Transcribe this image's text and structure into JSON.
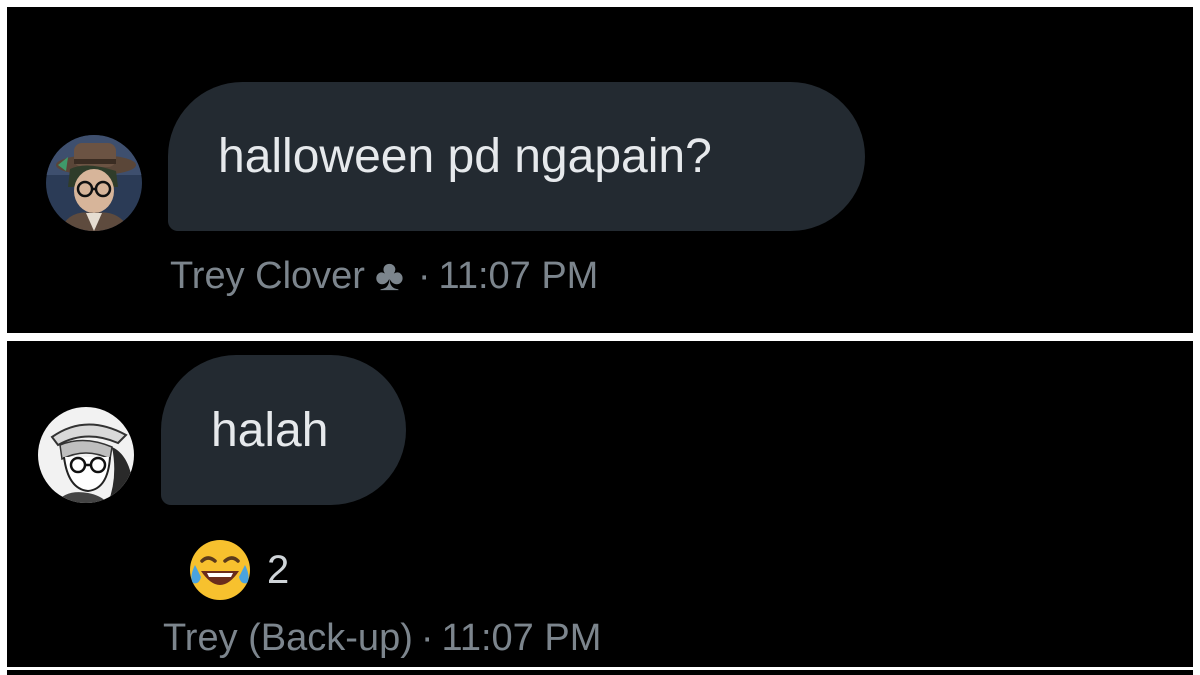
{
  "messages": [
    {
      "text": "halloween pd ngapain?",
      "sender": "Trey Clover",
      "sender_symbol": "♣",
      "separator": "·",
      "time": "11:07 PM",
      "avatar_icon": "hatted-glasses-avatar-icon"
    },
    {
      "text": "halah",
      "sender": "Trey (Back-up)",
      "separator": "·",
      "time": "11:07 PM",
      "avatar_icon": "sketch-glasses-avatar-icon",
      "reaction": {
        "emoji_icon": "tears-of-joy-emoji-icon",
        "count": "2"
      }
    }
  ],
  "colors": {
    "background": "#000000",
    "bubble": "#232a31",
    "bubble_text": "#e6e9ec",
    "meta_text": "#7c858d",
    "divider": "#ffffff"
  }
}
